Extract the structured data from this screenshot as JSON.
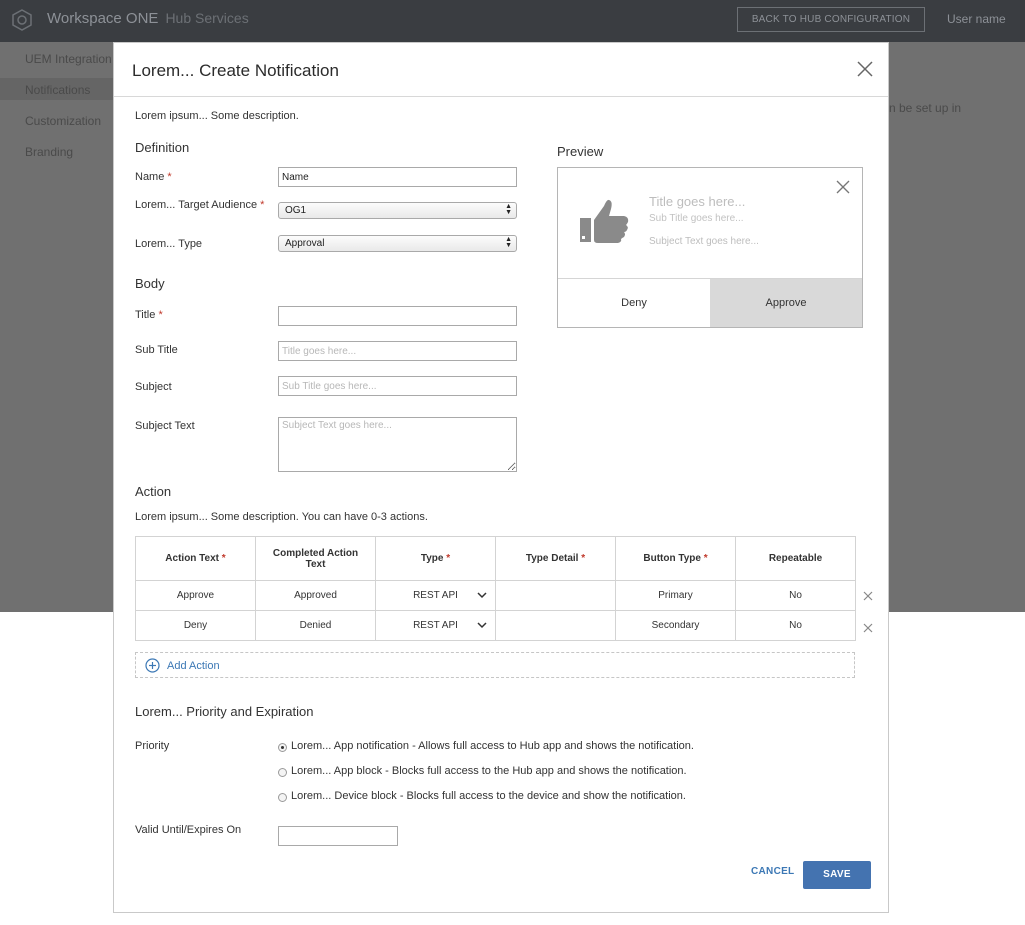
{
  "app": {
    "brand": "Workspace ONE",
    "product": "Hub Services",
    "back_button": "BACK TO HUB CONFIGURATION",
    "user_name": "User name"
  },
  "sidebar": {
    "items": [
      {
        "label": "UEM Integration"
      },
      {
        "label": "Notifications"
      },
      {
        "label": "Customization"
      },
      {
        "label": "Branding"
      }
    ],
    "active": "Notifications"
  },
  "background_text": "n be set up in",
  "modal": {
    "title": "Lorem... Create Notification",
    "description": "Lorem ipsum... Some description.",
    "definition": {
      "heading": "Definition",
      "name_label": "Name",
      "name_value": "Name",
      "target_label": "Lorem... Target Audience",
      "target_value": "OG1",
      "type_label": "Lorem... Type",
      "type_value": "Approval"
    },
    "body": {
      "heading": "Body",
      "title_label": "Title",
      "title_value": "",
      "subtitle_label": "Sub Title",
      "subtitle_placeholder": "Title goes here...",
      "subject_label": "Subject",
      "subject_placeholder": "Sub Title goes here...",
      "subject_text_label": "Subject Text",
      "subject_text_placeholder": "Subject Text goes here..."
    },
    "preview": {
      "heading": "Preview",
      "title": "Title goes here...",
      "subtitle": "Sub Title goes here...",
      "subject": "Subject Text goes here...",
      "deny": "Deny",
      "approve": "Approve"
    },
    "action": {
      "heading": "Action",
      "description": "Lorem ipsum... Some description. You can have 0-3 actions.",
      "columns": [
        "Action Text",
        "Completed Action Text",
        "Type",
        "Type Detail",
        "Button Type",
        "Repeatable"
      ],
      "rows": [
        {
          "action_text": "Approve",
          "completed": "Approved",
          "type": "REST API",
          "type_detail": "",
          "button_type": "Primary",
          "repeatable": "No"
        },
        {
          "action_text": "Deny",
          "completed": "Denied",
          "type": "REST API",
          "type_detail": "",
          "button_type": "Secondary",
          "repeatable": "No"
        }
      ],
      "add_label": "Add Action"
    },
    "priority": {
      "heading": "Lorem... Priority and Expiration",
      "label": "Priority",
      "options": [
        "Lorem... App notification - Allows full access to Hub app and shows the notification.",
        "Lorem... App block - Blocks full access to the Hub app and shows the notification.",
        "Lorem... Device block - Blocks full access to the device and show the notification."
      ],
      "selected_index": 0,
      "valid_label": "Valid Until/Expires On",
      "valid_value": ""
    },
    "cancel": "CANCEL",
    "save": "SAVE"
  },
  "colors": {
    "topbar": "#3a3d41",
    "overlay": "#707070",
    "accent": "#4473b0",
    "link": "#3c78b5",
    "required": "#c0392b"
  }
}
